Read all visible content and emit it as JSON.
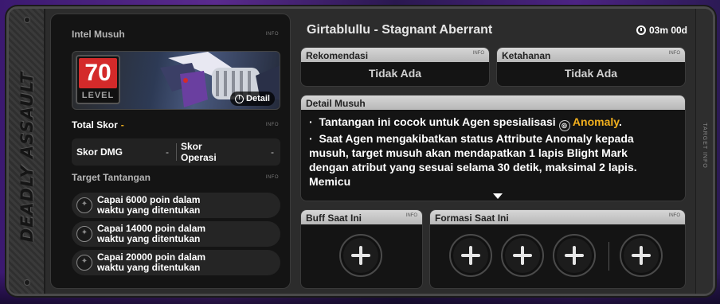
{
  "side": {
    "title": "DEADLY ASSAULT",
    "right_label": "TARGET INFO"
  },
  "left": {
    "intel_header": "Intel Musuh",
    "info_tag": "INFO",
    "level_value": "70",
    "level_label": "LEVEL",
    "detail_button": "Detail",
    "total_score_label": "Total Skor",
    "total_score_value": "-",
    "skor_dmg_label": "Skor DMG",
    "skor_dmg_value": "-",
    "skor_operasi_label": "Skor Operasi",
    "skor_operasi_value": "-",
    "target_header": "Target Tantangan",
    "targets": [
      {
        "line1": "Capai 6000 poin dalam",
        "line2": "waktu yang ditentukan"
      },
      {
        "line1": "Capai 14000 poin dalam",
        "line2": "waktu yang ditentukan"
      },
      {
        "line1": "Capai 20000 poin dalam",
        "line2": "waktu yang ditentukan"
      }
    ]
  },
  "right": {
    "boss_title": "Girtablullu - Stagnant Aberrant",
    "timer": "03m 00d",
    "rekomendasi": {
      "label": "Rekomendasi",
      "value": "Tidak Ada"
    },
    "ketahanan": {
      "label": "Ketahanan",
      "value": "Tidak Ada"
    },
    "detail": {
      "label": "Detail Musuh",
      "bullet1_prefix": "Tantangan ini cocok untuk Agen spesialisasi",
      "bullet1_highlight": "Anomaly",
      "bullet1_suffix": ".",
      "bullet2": "Saat Agen mengakibatkan status Attribute Anomaly kepada musuh, target musuh akan mendapatkan 1 lapis Blight Mark dengan atribut yang sesuai selama 30 detik, maksimal 2 lapis. Memicu"
    },
    "buff": {
      "label": "Buff Saat Ini"
    },
    "formasi": {
      "label": "Formasi Saat Ini"
    }
  },
  "colors": {
    "accent": "#f2b01e",
    "level_red": "#d42a2a",
    "header_bg": "#c8c8c8"
  }
}
